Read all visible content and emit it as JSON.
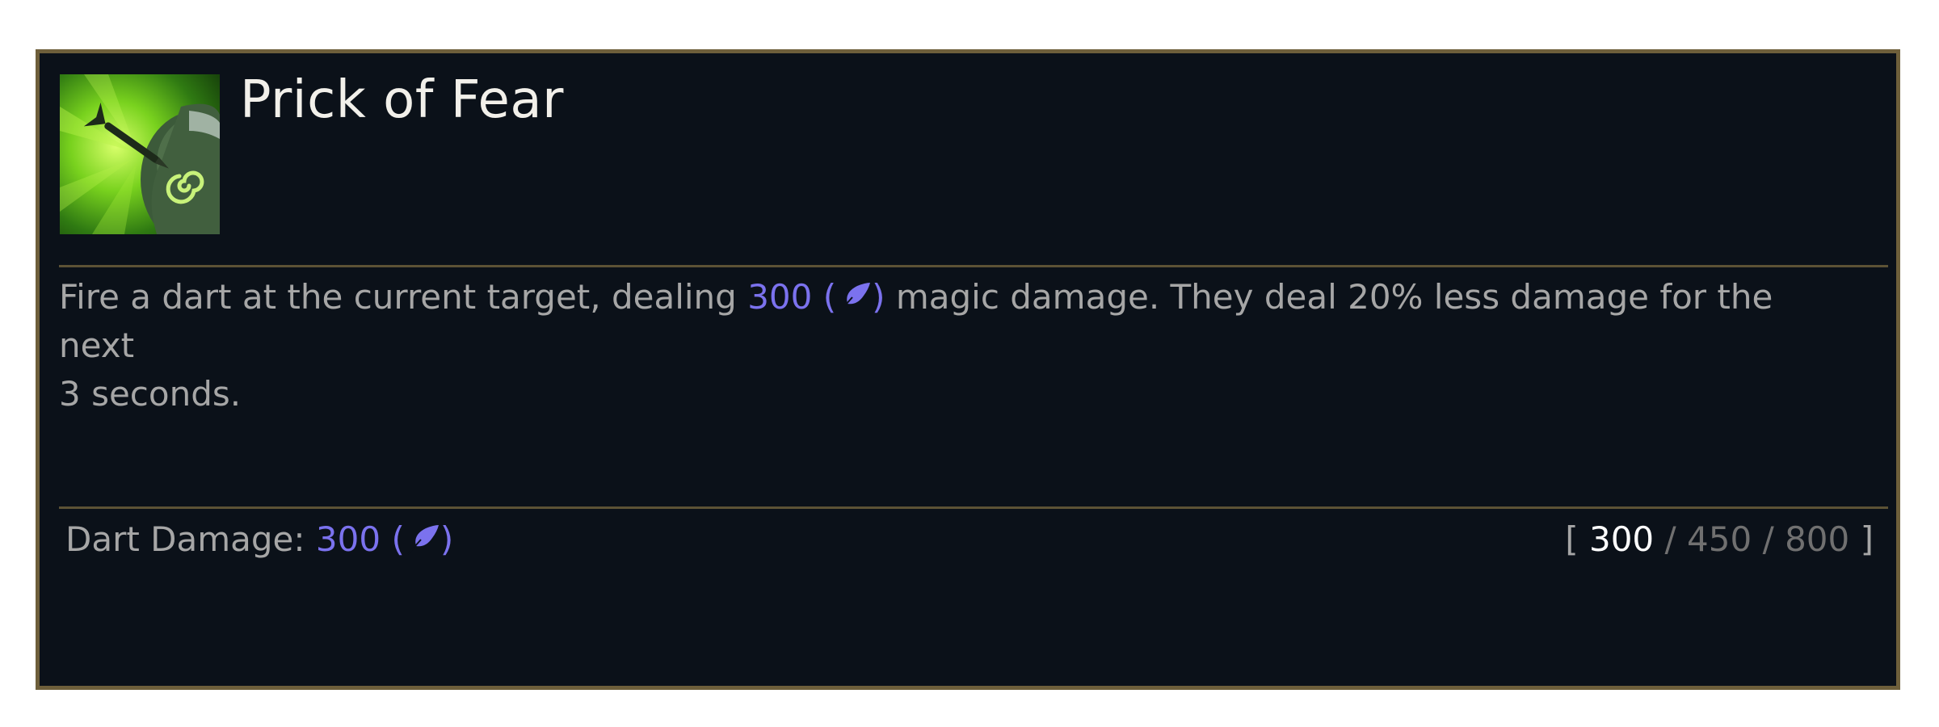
{
  "ability": {
    "name": "Prick of Fear",
    "icon": "dart-fear-ability-icon"
  },
  "description": {
    "before": "Fire a dart at the current target, dealing ",
    "damage_value": "300",
    "damage_open": "(",
    "damage_close": ")",
    "after": " magic damage. They deal 20% less damage for the next",
    "line2": "3 seconds.",
    "damage_icon": "ability-power-quill-icon"
  },
  "stats": {
    "label": "Dart Damage:",
    "value": "300",
    "open": "(",
    "close": ")",
    "bracket_open": "[",
    "bracket_close": "]",
    "separator": "/",
    "ranks": [
      "300",
      "450",
      "800"
    ]
  },
  "colors": {
    "background": "#0b1119",
    "border": "#6e5f3b",
    "magic": "#7b72ee",
    "text": "#a6a6a6",
    "title": "#f2f0ea"
  }
}
